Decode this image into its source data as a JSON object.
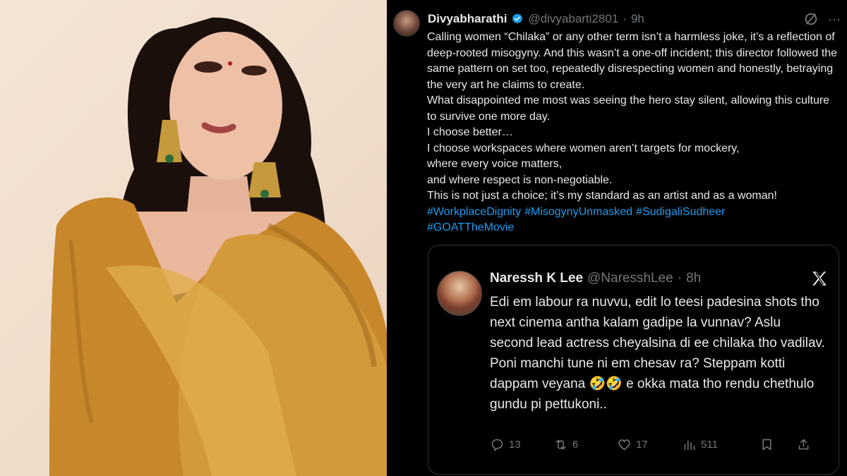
{
  "tweet": {
    "author_name": "Divyabharathi",
    "author_handle": "@divyabarti2801",
    "separator": "·",
    "time": "9h",
    "body_lines": [
      "Calling women “Chilaka” or any other term isn’t a harmless joke, it’s a reflection of deep-rooted misogyny. And this wasn’t a one-off incident; this director followed the same pattern on set too, repeatedly disrespecting women and honestly, betraying the very art he claims to create.",
      "What disappointed me most was seeing the hero stay silent, allowing this culture to survive one more day.",
      "I choose better…",
      "I choose workspaces where women aren’t targets for mockery,",
      "where every voice matters,",
      "and where respect is non-negotiable.",
      "This is not just a choice; it’s my standard as an artist and as a woman!"
    ],
    "hashtags": [
      "#WorkplaceDignity",
      "#MisogynyUnmasked",
      "#SudigaliSudheer",
      "#GOATTheMovie"
    ],
    "icons": {
      "verified": "verified-badge-icon",
      "grok": "grok-icon",
      "more": "more-icon"
    },
    "accent_color": "#1d9bf0"
  },
  "quoted": {
    "author_name": "Naressh K Lee",
    "author_handle": "@NaresshLee",
    "separator": "·",
    "time": "8h",
    "body": "Edi em labour ra nuvvu, edit lo teesi padesina shots tho next cinema antha kalam gadipe la vunnav? Aslu second lead actress cheyalsina di ee chilaka tho vadilav. Poni manchi tune ni em chesav ra? Steppam kotti dappam veyana 🤣🤣 e okka mata tho rendu chethulo gundu pi pettukoni..",
    "brand_icon": "x-logo-icon",
    "actions": {
      "replies": "13",
      "reposts": "6",
      "likes": "17",
      "views": "511"
    }
  }
}
